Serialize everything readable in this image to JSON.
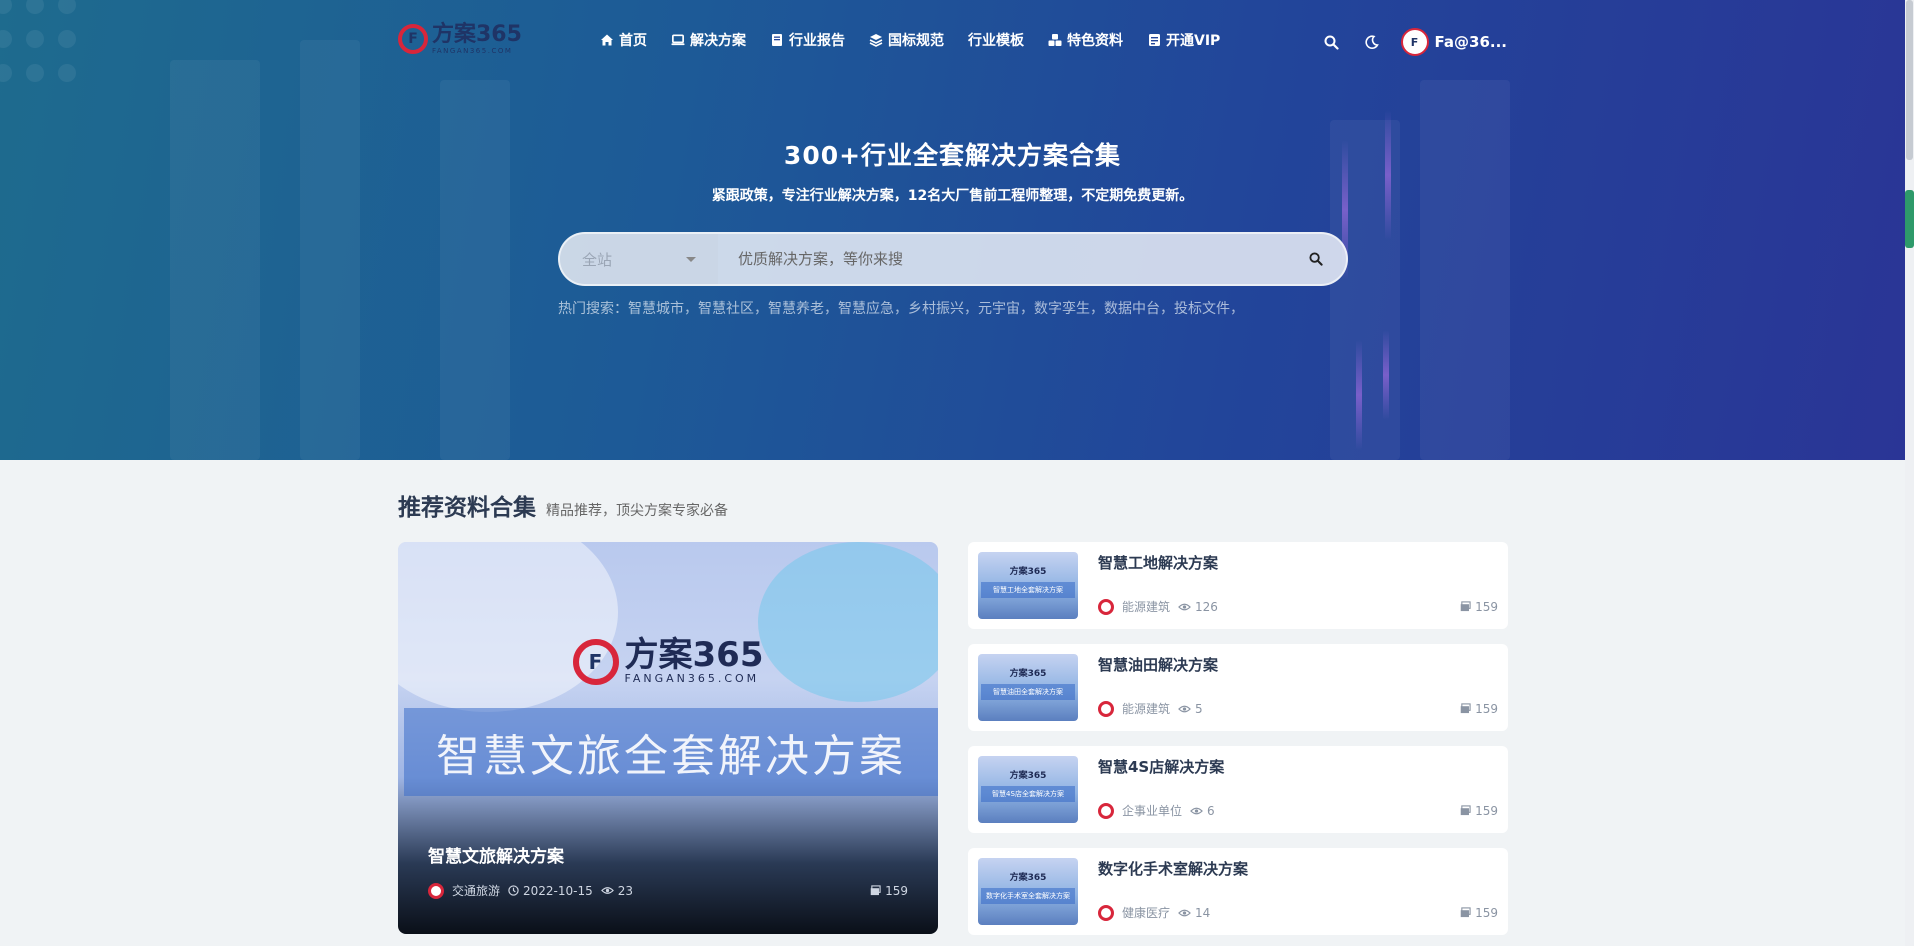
{
  "nav": {
    "logo_text": "方案365",
    "logo_sub": "FANGAN365.COM",
    "items": [
      {
        "label": "首页",
        "icon": "home-icon"
      },
      {
        "label": "解决方案",
        "icon": "laptop-icon"
      },
      {
        "label": "行业报告",
        "icon": "book-icon"
      },
      {
        "label": "国标规范",
        "icon": "layers-icon"
      },
      {
        "label": "行业模板",
        "icon": ""
      },
      {
        "label": "特色资料",
        "icon": "cubes-icon"
      },
      {
        "label": "开通VIP",
        "icon": "vip-icon"
      }
    ],
    "user_name": "Fa@36..."
  },
  "hero": {
    "title": "300+行业全套解决方案合集",
    "subtitle": "紧跟政策，专注行业解决方案，12名大厂售前工程师整理，不定期免费更新。",
    "search_scope": "全站",
    "search_placeholder": "优质解决方案，等你来搜",
    "hot_label": "热门搜索：",
    "hot_keywords": [
      "智慧城市，",
      "智慧社区，",
      "智慧养老，",
      "智慧应急，",
      "乡村振兴，",
      "元宇宙，",
      "数字孪生，",
      "数据中台，",
      "投标文件，"
    ]
  },
  "section": {
    "title": "推荐资料合集",
    "desc": "精品推荐，顶尖方案专家必备"
  },
  "feature": {
    "logo_text": "方案365",
    "logo_sub": "FANGAN365.COM",
    "banner": "智慧文旅全套解决方案",
    "title": "智慧文旅解决方案",
    "category": "交通旅游",
    "date": "2022-10-15",
    "views": "23",
    "count": "159"
  },
  "cards": [
    {
      "title": "智慧工地解决方案",
      "thumb_text": "智慧工地全套解决方案",
      "category": "能源建筑",
      "views": "126",
      "count": "159"
    },
    {
      "title": "智慧油田解决方案",
      "thumb_text": "智慧油田全套解决方案",
      "category": "能源建筑",
      "views": "5",
      "count": "159"
    },
    {
      "title": "智慧4S店解决方案",
      "thumb_text": "智慧4S店全套解决方案",
      "category": "企事业单位",
      "views": "6",
      "count": "159"
    },
    {
      "title": "数字化手术室解决方案",
      "thumb_text": "数字化手术室全套解决方案",
      "category": "健康医疗",
      "views": "14",
      "count": "159"
    }
  ],
  "colors": {
    "brand_red": "#d8263b",
    "brand_navy": "#1f3466",
    "hero_start": "#1e6b8e",
    "hero_end": "#2a3596"
  }
}
